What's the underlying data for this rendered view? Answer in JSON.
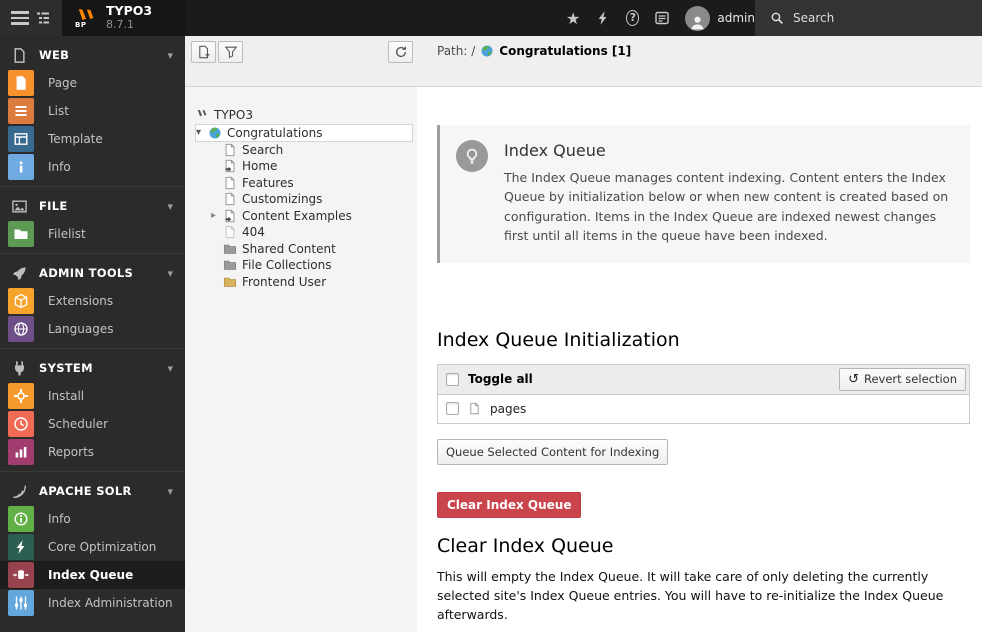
{
  "topbar": {
    "product": "TYPO3",
    "version": "8.7.1",
    "logo_badge": "BP",
    "username": "admin",
    "search_placeholder": "Search"
  },
  "sidebar": {
    "sections": [
      {
        "label": "WEB",
        "items": [
          {
            "label": "Page",
            "color": "#f7922d"
          },
          {
            "label": "List",
            "color": "#dd7c3f"
          },
          {
            "label": "Template",
            "color": "#38698f"
          },
          {
            "label": "Info",
            "color": "#6fabe2"
          }
        ]
      },
      {
        "label": "FILE",
        "items": [
          {
            "label": "Filelist",
            "color": "#5d9a53"
          }
        ]
      },
      {
        "label": "ADMIN TOOLS",
        "items": [
          {
            "label": "Extensions",
            "color": "#f7a42d"
          },
          {
            "label": "Languages",
            "color": "#6e4f87"
          }
        ]
      },
      {
        "label": "SYSTEM",
        "items": [
          {
            "label": "Install",
            "color": "#f79a2d"
          },
          {
            "label": "Scheduler",
            "color": "#ef6b56"
          },
          {
            "label": "Reports",
            "color": "#a23c6f"
          }
        ]
      },
      {
        "label": "APACHE SOLR",
        "items": [
          {
            "label": "Info",
            "color": "#62b147"
          },
          {
            "label": "Core Optimization",
            "color": "#2c5f51"
          },
          {
            "label": "Index Queue",
            "color": "#97424f"
          },
          {
            "label": "Index Administration",
            "color": "#64a7dd"
          }
        ]
      }
    ]
  },
  "tree": {
    "root": "TYPO3",
    "items": [
      {
        "label": "Congratulations"
      },
      {
        "label": "Search"
      },
      {
        "label": "Home"
      },
      {
        "label": "Features"
      },
      {
        "label": "Customizings"
      },
      {
        "label": "Content Examples"
      },
      {
        "label": "404"
      },
      {
        "label": "Shared Content"
      },
      {
        "label": "File Collections"
      },
      {
        "label": "Frontend User"
      }
    ]
  },
  "docheader": {
    "path_label": "Path: /",
    "page_title": "Congratulations [1]"
  },
  "main": {
    "notice": {
      "title": "Index Queue",
      "body": "The Index Queue manages content indexing. Content enters the Index Queue by initialization below or when new content is created based on configuration. Items in the Index Queue are indexed newest changes first until all items in the queue have been indexed."
    },
    "initialization": {
      "heading": "Index Queue Initialization",
      "toggle_all_label": "Toggle all",
      "revert_button_label": "Revert selection",
      "rows": [
        {
          "label": "pages"
        }
      ],
      "queue_button_label": "Queue Selected Content for Indexing"
    },
    "clear": {
      "button_label": "Clear Index Queue",
      "heading": "Clear Index Queue",
      "body": "This will empty the Index Queue. It will take care of only deleting the currently selected site's Index Queue entries. You will have to re-initialize the Index Queue afterwards."
    }
  },
  "colors": {
    "danger": "#c9444b",
    "accent": "#ff8700",
    "topbar_bg": "#1b1b1b",
    "sidebar_bg": "#2b2b2b"
  }
}
